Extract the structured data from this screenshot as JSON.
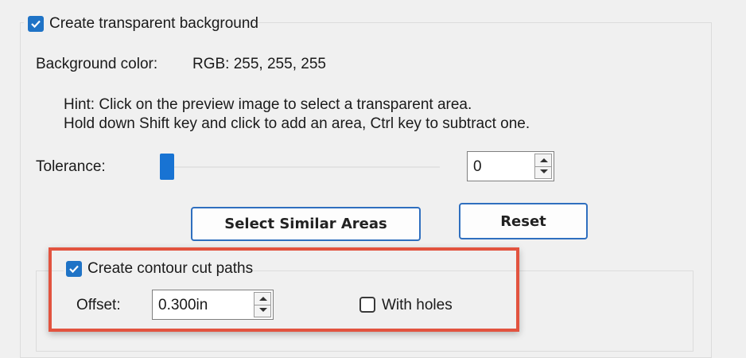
{
  "transparent": {
    "checkbox_label": "Create transparent background",
    "checked": true,
    "bg_color_label": "Background color:",
    "bg_color_value": "RGB: 255, 255, 255",
    "hint_line1": "Hint: Click on the preview image to select a transparent area.",
    "hint_line2": "Hold down Shift key and click to add an area, Ctrl key to subtract one.",
    "tolerance_label": "Tolerance:",
    "tolerance_value": "0",
    "select_similar_label": "Select Similar Areas",
    "reset_label": "Reset"
  },
  "contour": {
    "checkbox_label": "Create contour cut paths",
    "checked": true,
    "offset_label": "Offset:",
    "offset_value": "0.300in",
    "with_holes_label": "With holes",
    "with_holes_checked": false
  },
  "colors": {
    "accent": "#1f73c6",
    "highlight": "#e2533f"
  }
}
